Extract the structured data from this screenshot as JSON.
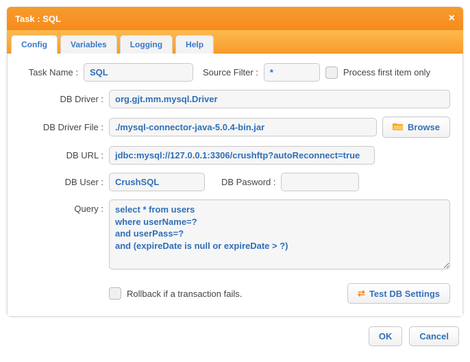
{
  "dialog": {
    "title": "Task : SQL",
    "close_icon": "×"
  },
  "tabs": [
    {
      "label": "Config",
      "active": true
    },
    {
      "label": "Variables",
      "active": false
    },
    {
      "label": "Logging",
      "active": false
    },
    {
      "label": "Help",
      "active": false
    }
  ],
  "form": {
    "task_name_label": "Task Name :",
    "task_name_value": "SQL",
    "source_filter_label": "Source Filter :",
    "source_filter_value": "*",
    "process_first_label": "Process first item only",
    "db_driver_label": "DB Driver :",
    "db_driver_value": "org.gjt.mm.mysql.Driver",
    "db_driver_file_label": "DB Driver File :",
    "db_driver_file_value": "./mysql-connector-java-5.0.4-bin.jar",
    "browse_label": "Browse",
    "db_url_label": "DB URL :",
    "db_url_value": "jdbc:mysql://127.0.0.1:3306/crushftp?autoReconnect=true",
    "db_user_label": "DB User :",
    "db_user_value": "CrushSQL",
    "db_password_label": "DB Pasword :",
    "db_password_value": "",
    "query_label": "Query :",
    "query_value": "select * from users\nwhere userName=?\nand userPass=?\nand (expireDate is null or expireDate > ?)",
    "rollback_label": "Rollback if a transaction fails.",
    "test_db_label": "Test DB Settings"
  },
  "footer": {
    "ok_label": "OK",
    "cancel_label": "Cancel"
  }
}
